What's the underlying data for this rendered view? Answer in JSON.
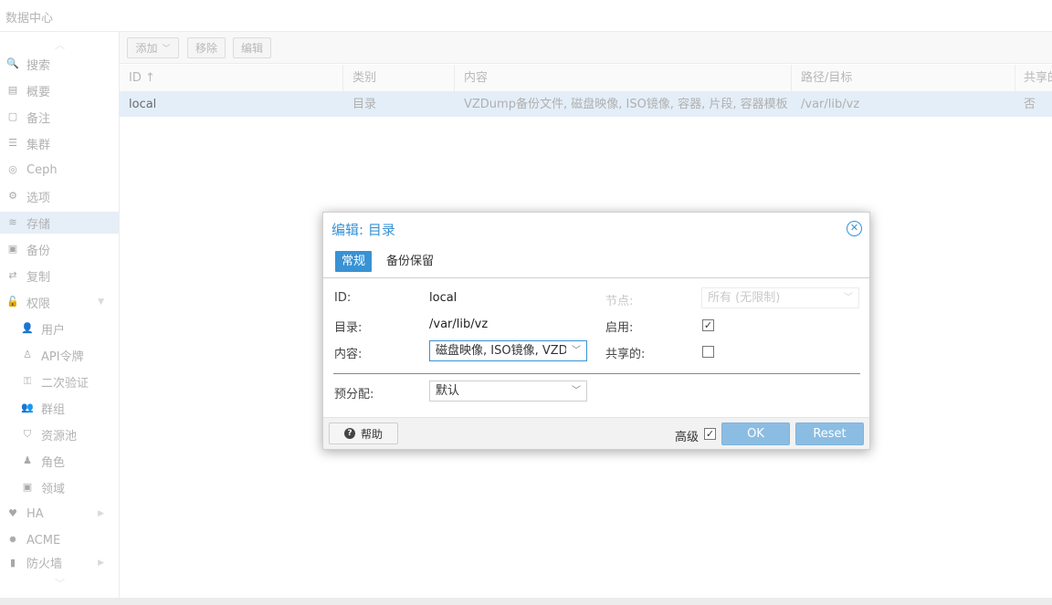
{
  "header": {
    "title": "数据中心"
  },
  "sidebar": {
    "items": [
      {
        "label": "搜索",
        "icon": "search-icon",
        "glyph": "🔍"
      },
      {
        "label": "概要",
        "icon": "book-icon",
        "glyph": "▤"
      },
      {
        "label": "备注",
        "icon": "note-icon",
        "glyph": "▢"
      },
      {
        "label": "集群",
        "icon": "server-icon",
        "glyph": "☰"
      },
      {
        "label": "Ceph",
        "icon": "ceph-icon",
        "glyph": "◎"
      },
      {
        "label": "选项",
        "icon": "gear-icon",
        "glyph": "⚙"
      },
      {
        "label": "存储",
        "icon": "database-icon",
        "glyph": "≋"
      },
      {
        "label": "备份",
        "icon": "floppy-icon",
        "glyph": "▣"
      },
      {
        "label": "复制",
        "icon": "retweet-icon",
        "glyph": "⇄"
      },
      {
        "label": "权限",
        "icon": "unlock-icon",
        "glyph": "🔓"
      },
      {
        "label": "用户",
        "icon": "user-icon",
        "glyph": "👤"
      },
      {
        "label": "API令牌",
        "icon": "user-outline-icon",
        "glyph": "♙"
      },
      {
        "label": "二次验证",
        "icon": "key-icon",
        "glyph": "⚿"
      },
      {
        "label": "群组",
        "icon": "users-icon",
        "glyph": "👥"
      },
      {
        "label": "资源池",
        "icon": "tags-icon",
        "glyph": "⛉"
      },
      {
        "label": "角色",
        "icon": "male-icon",
        "glyph": "♟"
      },
      {
        "label": "领域",
        "icon": "address-book-icon",
        "glyph": "▣"
      },
      {
        "label": "HA",
        "icon": "heartbeat-icon",
        "glyph": "♥"
      },
      {
        "label": "ACME",
        "icon": "certificate-icon",
        "glyph": "✹"
      },
      {
        "label": "防火墙",
        "icon": "shield-icon",
        "glyph": "▮"
      }
    ]
  },
  "toolbar": {
    "add_label": "添加",
    "remove_label": "移除",
    "edit_label": "编辑"
  },
  "grid": {
    "columns": [
      "ID ↑",
      "类别",
      "内容",
      "路径/目标",
      "共享的"
    ],
    "rows": [
      [
        "local",
        "目录",
        "VZDump备份文件, 磁盘映像, ISO镜像, 容器, 片段, 容器模板",
        "/var/lib/vz",
        "否"
      ]
    ]
  },
  "dialog": {
    "title": "编辑: 目录",
    "tabs": [
      "常规",
      "备份保留"
    ],
    "fields": {
      "id_label": "ID:",
      "id_value": "local",
      "dir_label": "目录:",
      "dir_value": "/var/lib/vz",
      "content_label": "内容:",
      "content_value": "磁盘映像, ISO镜像, VZDump备份文件, 容器, 片段, 容器模板",
      "node_label": "节点:",
      "node_value": "所有 (无限制)",
      "enable_label": "启用:",
      "enable_checked": true,
      "shared_label": "共享的:",
      "shared_checked": false,
      "prealloc_label": "预分配:",
      "prealloc_value": "默认"
    },
    "footer": {
      "help_label": "帮助",
      "advanced_label": "高级",
      "advanced_checked": true,
      "ok_label": "OK",
      "reset_label": "Reset"
    }
  },
  "colors": {
    "accent": "#3892d4",
    "selected_row": "#e4eef8",
    "button_primary": "#8bbde3"
  }
}
